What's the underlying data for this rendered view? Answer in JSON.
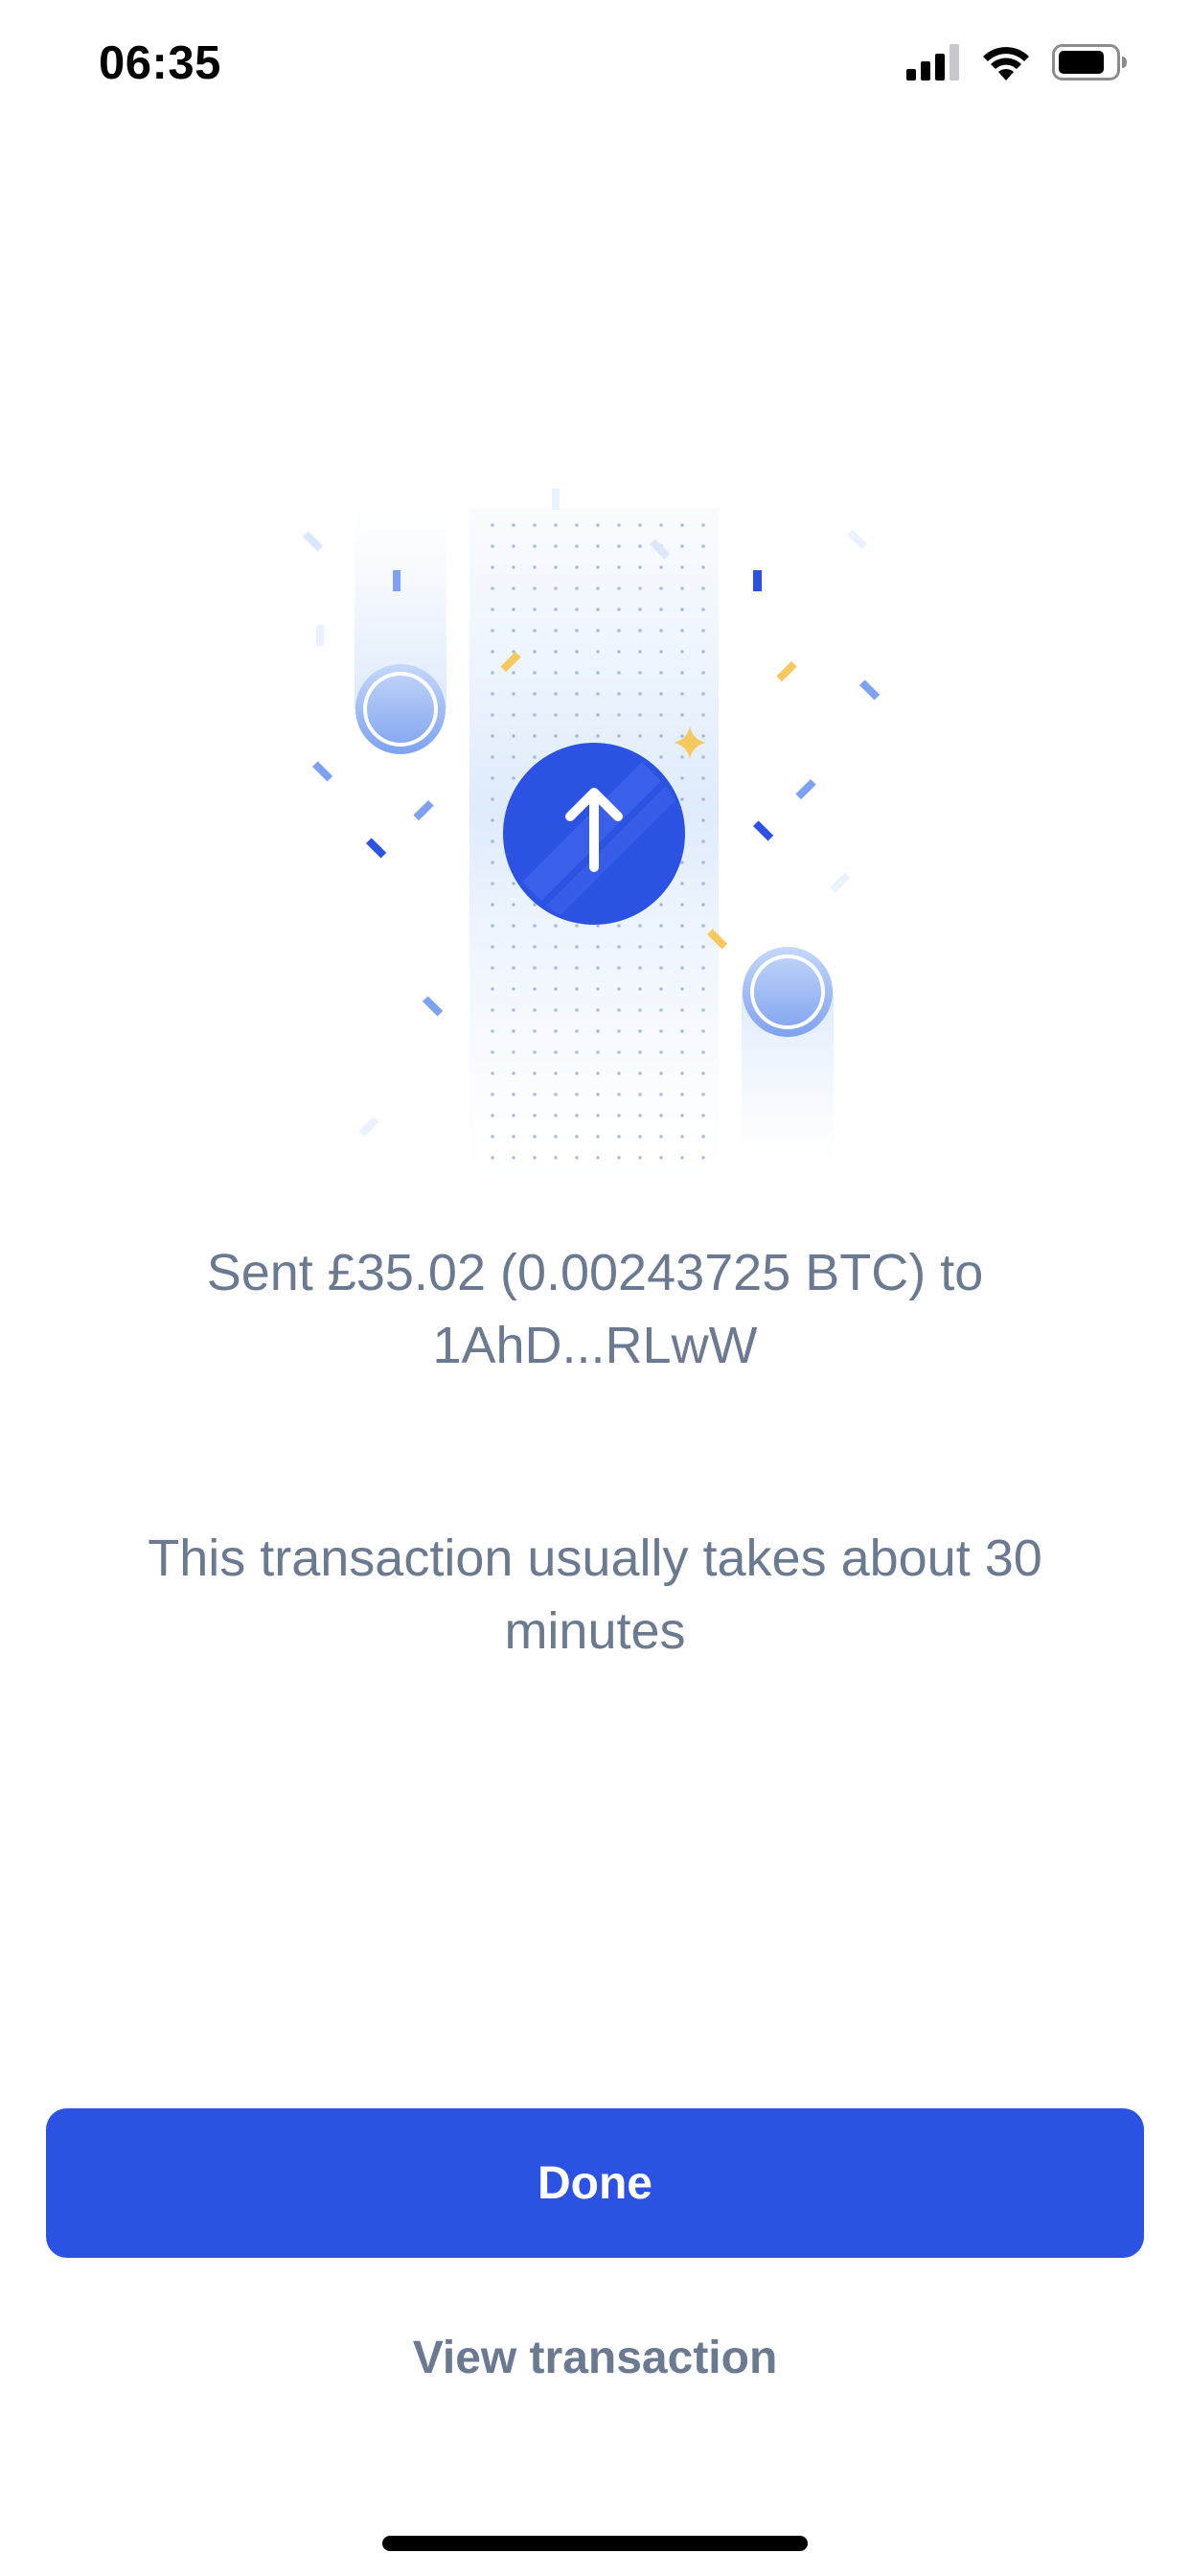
{
  "status_bar": {
    "time": "06:35",
    "icons": [
      "cellular-signal-icon",
      "wifi-icon",
      "battery-icon"
    ]
  },
  "illustration": {
    "icon": "arrow-up-icon",
    "accent_color": "#2c52e3",
    "highlight_color": "#f5c95f"
  },
  "message": {
    "sent_line1": "Sent £35.02 (0.00243725 BTC) to",
    "sent_line2": "1AhD...RLwW",
    "info_line1": "This transaction usually takes about 30",
    "info_line2": "minutes"
  },
  "actions": {
    "done_label": "Done",
    "view_label": "View transaction"
  },
  "colors": {
    "primary": "#2c52e3",
    "text_muted": "#6b7a90",
    "background": "#ffffff"
  }
}
